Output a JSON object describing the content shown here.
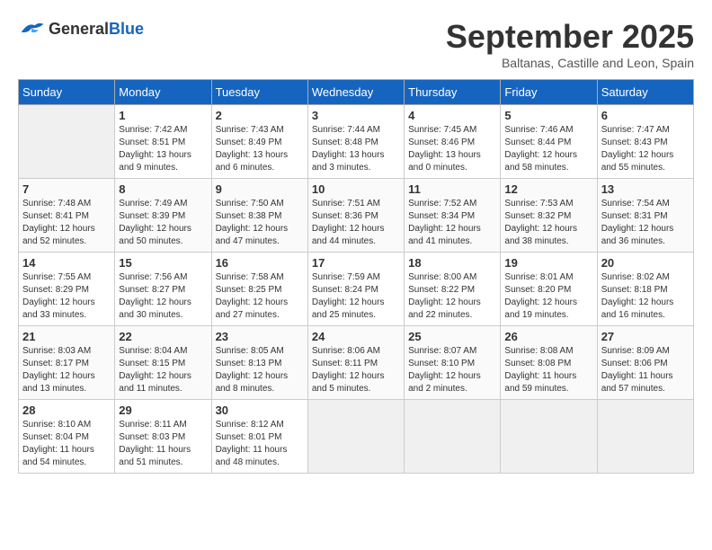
{
  "logo": {
    "general": "General",
    "blue": "Blue"
  },
  "header": {
    "month": "September 2025",
    "location": "Baltanas, Castille and Leon, Spain"
  },
  "weekdays": [
    "Sunday",
    "Monday",
    "Tuesday",
    "Wednesday",
    "Thursday",
    "Friday",
    "Saturday"
  ],
  "weeks": [
    [
      {
        "day": "",
        "sunrise": "",
        "sunset": "",
        "daylight": ""
      },
      {
        "day": "1",
        "sunrise": "Sunrise: 7:42 AM",
        "sunset": "Sunset: 8:51 PM",
        "daylight": "Daylight: 13 hours and 9 minutes."
      },
      {
        "day": "2",
        "sunrise": "Sunrise: 7:43 AM",
        "sunset": "Sunset: 8:49 PM",
        "daylight": "Daylight: 13 hours and 6 minutes."
      },
      {
        "day": "3",
        "sunrise": "Sunrise: 7:44 AM",
        "sunset": "Sunset: 8:48 PM",
        "daylight": "Daylight: 13 hours and 3 minutes."
      },
      {
        "day": "4",
        "sunrise": "Sunrise: 7:45 AM",
        "sunset": "Sunset: 8:46 PM",
        "daylight": "Daylight: 13 hours and 0 minutes."
      },
      {
        "day": "5",
        "sunrise": "Sunrise: 7:46 AM",
        "sunset": "Sunset: 8:44 PM",
        "daylight": "Daylight: 12 hours and 58 minutes."
      },
      {
        "day": "6",
        "sunrise": "Sunrise: 7:47 AM",
        "sunset": "Sunset: 8:43 PM",
        "daylight": "Daylight: 12 hours and 55 minutes."
      }
    ],
    [
      {
        "day": "7",
        "sunrise": "Sunrise: 7:48 AM",
        "sunset": "Sunset: 8:41 PM",
        "daylight": "Daylight: 12 hours and 52 minutes."
      },
      {
        "day": "8",
        "sunrise": "Sunrise: 7:49 AM",
        "sunset": "Sunset: 8:39 PM",
        "daylight": "Daylight: 12 hours and 50 minutes."
      },
      {
        "day": "9",
        "sunrise": "Sunrise: 7:50 AM",
        "sunset": "Sunset: 8:38 PM",
        "daylight": "Daylight: 12 hours and 47 minutes."
      },
      {
        "day": "10",
        "sunrise": "Sunrise: 7:51 AM",
        "sunset": "Sunset: 8:36 PM",
        "daylight": "Daylight: 12 hours and 44 minutes."
      },
      {
        "day": "11",
        "sunrise": "Sunrise: 7:52 AM",
        "sunset": "Sunset: 8:34 PM",
        "daylight": "Daylight: 12 hours and 41 minutes."
      },
      {
        "day": "12",
        "sunrise": "Sunrise: 7:53 AM",
        "sunset": "Sunset: 8:32 PM",
        "daylight": "Daylight: 12 hours and 38 minutes."
      },
      {
        "day": "13",
        "sunrise": "Sunrise: 7:54 AM",
        "sunset": "Sunset: 8:31 PM",
        "daylight": "Daylight: 12 hours and 36 minutes."
      }
    ],
    [
      {
        "day": "14",
        "sunrise": "Sunrise: 7:55 AM",
        "sunset": "Sunset: 8:29 PM",
        "daylight": "Daylight: 12 hours and 33 minutes."
      },
      {
        "day": "15",
        "sunrise": "Sunrise: 7:56 AM",
        "sunset": "Sunset: 8:27 PM",
        "daylight": "Daylight: 12 hours and 30 minutes."
      },
      {
        "day": "16",
        "sunrise": "Sunrise: 7:58 AM",
        "sunset": "Sunset: 8:25 PM",
        "daylight": "Daylight: 12 hours and 27 minutes."
      },
      {
        "day": "17",
        "sunrise": "Sunrise: 7:59 AM",
        "sunset": "Sunset: 8:24 PM",
        "daylight": "Daylight: 12 hours and 25 minutes."
      },
      {
        "day": "18",
        "sunrise": "Sunrise: 8:00 AM",
        "sunset": "Sunset: 8:22 PM",
        "daylight": "Daylight: 12 hours and 22 minutes."
      },
      {
        "day": "19",
        "sunrise": "Sunrise: 8:01 AM",
        "sunset": "Sunset: 8:20 PM",
        "daylight": "Daylight: 12 hours and 19 minutes."
      },
      {
        "day": "20",
        "sunrise": "Sunrise: 8:02 AM",
        "sunset": "Sunset: 8:18 PM",
        "daylight": "Daylight: 12 hours and 16 minutes."
      }
    ],
    [
      {
        "day": "21",
        "sunrise": "Sunrise: 8:03 AM",
        "sunset": "Sunset: 8:17 PM",
        "daylight": "Daylight: 12 hours and 13 minutes."
      },
      {
        "day": "22",
        "sunrise": "Sunrise: 8:04 AM",
        "sunset": "Sunset: 8:15 PM",
        "daylight": "Daylight: 12 hours and 11 minutes."
      },
      {
        "day": "23",
        "sunrise": "Sunrise: 8:05 AM",
        "sunset": "Sunset: 8:13 PM",
        "daylight": "Daylight: 12 hours and 8 minutes."
      },
      {
        "day": "24",
        "sunrise": "Sunrise: 8:06 AM",
        "sunset": "Sunset: 8:11 PM",
        "daylight": "Daylight: 12 hours and 5 minutes."
      },
      {
        "day": "25",
        "sunrise": "Sunrise: 8:07 AM",
        "sunset": "Sunset: 8:10 PM",
        "daylight": "Daylight: 12 hours and 2 minutes."
      },
      {
        "day": "26",
        "sunrise": "Sunrise: 8:08 AM",
        "sunset": "Sunset: 8:08 PM",
        "daylight": "Daylight: 11 hours and 59 minutes."
      },
      {
        "day": "27",
        "sunrise": "Sunrise: 8:09 AM",
        "sunset": "Sunset: 8:06 PM",
        "daylight": "Daylight: 11 hours and 57 minutes."
      }
    ],
    [
      {
        "day": "28",
        "sunrise": "Sunrise: 8:10 AM",
        "sunset": "Sunset: 8:04 PM",
        "daylight": "Daylight: 11 hours and 54 minutes."
      },
      {
        "day": "29",
        "sunrise": "Sunrise: 8:11 AM",
        "sunset": "Sunset: 8:03 PM",
        "daylight": "Daylight: 11 hours and 51 minutes."
      },
      {
        "day": "30",
        "sunrise": "Sunrise: 8:12 AM",
        "sunset": "Sunset: 8:01 PM",
        "daylight": "Daylight: 11 hours and 48 minutes."
      },
      {
        "day": "",
        "sunrise": "",
        "sunset": "",
        "daylight": ""
      },
      {
        "day": "",
        "sunrise": "",
        "sunset": "",
        "daylight": ""
      },
      {
        "day": "",
        "sunrise": "",
        "sunset": "",
        "daylight": ""
      },
      {
        "day": "",
        "sunrise": "",
        "sunset": "",
        "daylight": ""
      }
    ]
  ]
}
